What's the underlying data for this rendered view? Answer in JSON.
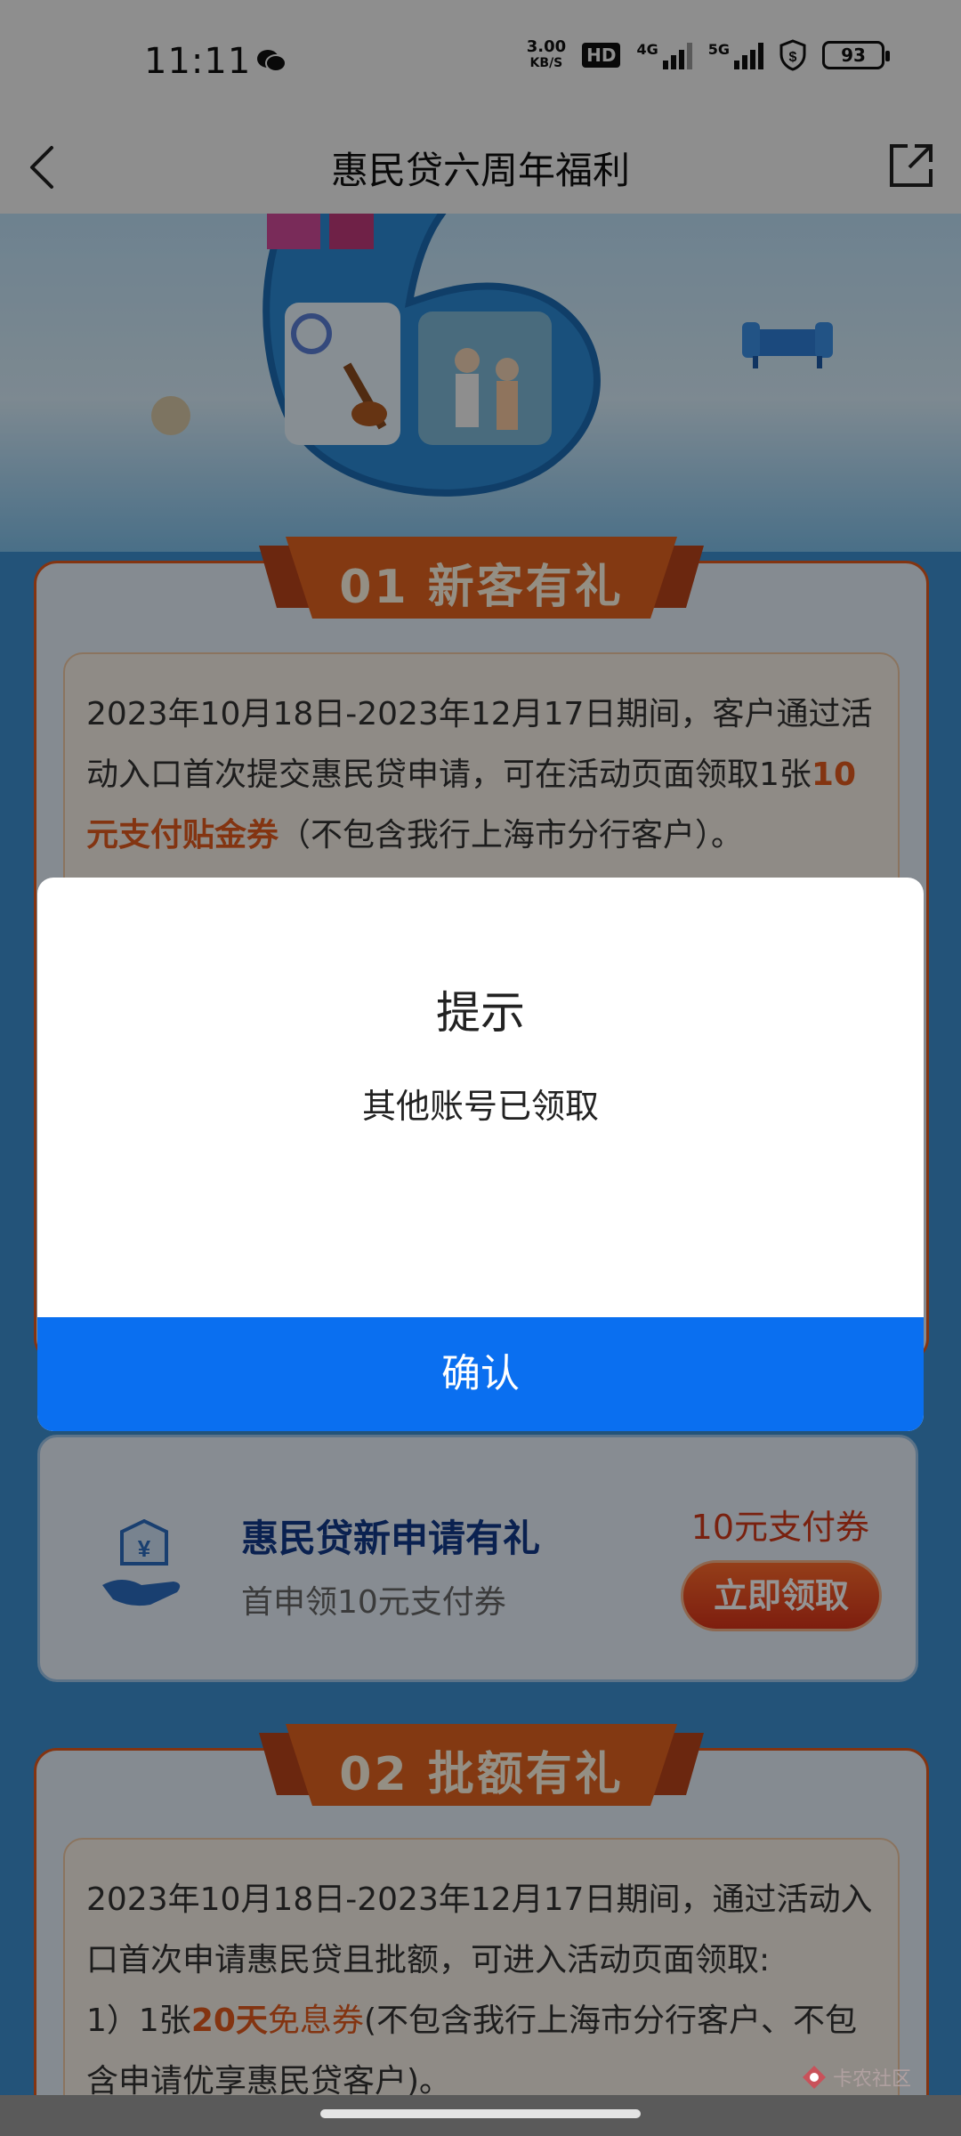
{
  "status_bar": {
    "time": "11:11",
    "net_speed_value": "3.00",
    "net_speed_unit": "KB/S",
    "hd_label": "HD",
    "signal1_label": "4G",
    "signal2_label": "5G",
    "battery": "93"
  },
  "nav": {
    "title": "惠民贷六周年福利"
  },
  "section1": {
    "ribbon": "01 新客有礼",
    "rule_text_a": "2023年10月18日-2023年12月17日期间，客户通过活动入口首次提交惠民贷申请，可在活动页面领取1张",
    "rule_highlight": "10元支付贴金券",
    "rule_text_b": "（不包含我行上海市分行客户）。"
  },
  "offer": {
    "title": "惠民贷新申请有礼",
    "subtitle": "首申领10元支付券",
    "price": "10元支付券",
    "button": "立即领取"
  },
  "section2": {
    "ribbon": "02 批额有礼",
    "rule_text_a": "2023年10月18日-2023年12月17日期间，通过活动入口首次申请惠民贷且批额，可进入活动页面领取:",
    "rule_item_prefix": "1）1张",
    "rule_highlight_bold": "20天",
    "rule_highlight": "免息券",
    "rule_text_b": "(不包含我行上海市分行客户、不包含申请优享惠民贷客户)。"
  },
  "dialog": {
    "title": "提示",
    "message": "其他账号已领取",
    "confirm": "确认"
  },
  "watermark": {
    "text": "卡农社区"
  },
  "colors": {
    "accent_blue": "#0a6ff0",
    "accent_orange": "#e25a1e",
    "offer_title": "#123a8a"
  }
}
